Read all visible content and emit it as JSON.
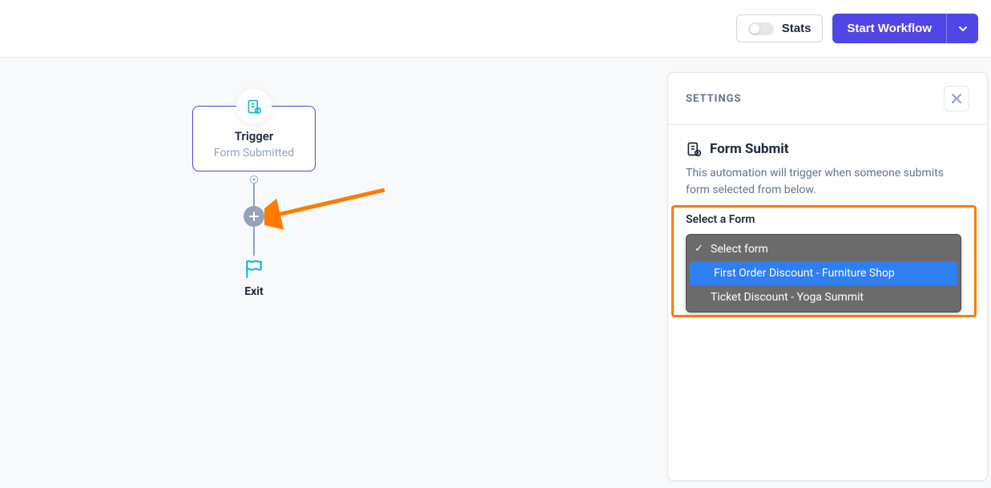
{
  "header": {
    "stats_label": "Stats",
    "start_label": "Start Workflow"
  },
  "canvas": {
    "trigger": {
      "title": "Trigger",
      "subtitle": "Form Submitted"
    },
    "exit_label": "Exit"
  },
  "sidebar": {
    "header_title": "SETTINGS",
    "section_title": "Form Submit",
    "section_desc": "This automation will trigger when someone submits form selected from below.",
    "select_label": "Select a Form",
    "dropdown": {
      "placeholder": "Select form",
      "options": [
        "First Order Discount - Furniture Shop",
        "Ticket Discount - Yoga Summit"
      ]
    }
  },
  "colors": {
    "primary": "#4f46e5",
    "accent_orange": "#ff7a00",
    "teal": "#17b7d1"
  }
}
